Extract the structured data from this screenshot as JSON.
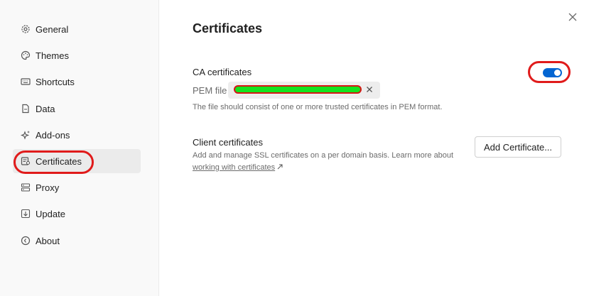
{
  "sidebar": {
    "items": [
      {
        "label": "General",
        "icon": "gear-icon"
      },
      {
        "label": "Themes",
        "icon": "palette-icon"
      },
      {
        "label": "Shortcuts",
        "icon": "keyboard-icon"
      },
      {
        "label": "Data",
        "icon": "document-icon"
      },
      {
        "label": "Add-ons",
        "icon": "sparkle-icon"
      },
      {
        "label": "Certificates",
        "icon": "certificate-icon",
        "active": true
      },
      {
        "label": "Proxy",
        "icon": "server-icon"
      },
      {
        "label": "Update",
        "icon": "download-icon"
      },
      {
        "label": "About",
        "icon": "info-icon"
      }
    ]
  },
  "main": {
    "title": "Certificates",
    "ca": {
      "label": "CA certificates",
      "enabled": true,
      "pem_label": "PEM file",
      "pem_value": "",
      "help": "The file should consist of one or more trusted certificates in PEM format."
    },
    "client": {
      "label": "Client certificates",
      "description": "Add and manage SSL certificates on a per domain basis. Learn more about ",
      "link_text": "working with certificates",
      "add_button": "Add Certificate..."
    }
  },
  "colors": {
    "accent": "#0265d2",
    "highlight_ring": "#e01b1b",
    "active_bg": "#ebebeb",
    "sidebar_bg": "#f9f9f9"
  }
}
